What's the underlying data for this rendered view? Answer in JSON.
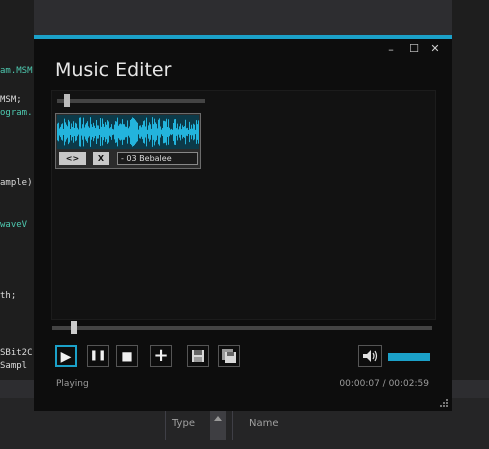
{
  "ide": {
    "code_lines": [
      {
        "text": "am.MSM",
        "style": "g"
      },
      {
        "text": "MSM;",
        "style": ""
      },
      {
        "text": "ogram.",
        "style": "g"
      },
      {
        "text": "ample)",
        "style": ""
      },
      {
        "text": " waveV",
        "style": "g"
      },
      {
        "text": "th;",
        "style": ""
      },
      {
        "text": "SBit2C",
        "style": ""
      },
      {
        "text": " Sampl",
        "style": ""
      }
    ],
    "columns": {
      "type": "Type",
      "name": "Name"
    }
  },
  "window": {
    "title": "Music Editer",
    "controls": {
      "minimize": "–",
      "maximize": "☐",
      "close": "✕"
    },
    "clip": {
      "swap_label": "<>",
      "close_label": "X",
      "name": "- 03 Bebalee",
      "slider_level": 0.05
    },
    "playback_level": 0.05,
    "toolbar": {
      "play": "▶",
      "pause": "❚❚",
      "stop": "■",
      "add": "+",
      "save_icon": "save-icon",
      "save_all_icon": "save-all-icon",
      "volume_icon": "speaker-icon"
    },
    "volume_level": 1.0,
    "status": "Playing",
    "time": "00:00:07 / 00:02:59",
    "accent": "#1ba1c9"
  }
}
